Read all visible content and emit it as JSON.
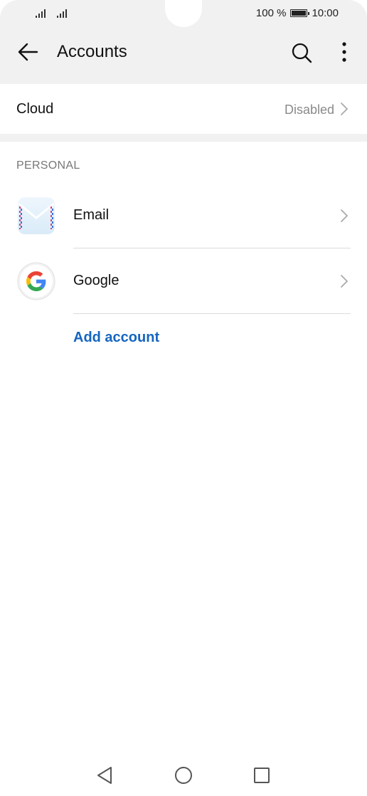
{
  "status_bar": {
    "battery_text": "100 %",
    "time": "10:00"
  },
  "app_bar": {
    "title": "Accounts",
    "back_icon": "arrow-left-icon",
    "search_icon": "search-icon",
    "more_icon": "more-vertical-icon"
  },
  "cloud": {
    "label": "Cloud",
    "value": "Disabled"
  },
  "personal": {
    "header": "PERSONAL",
    "accounts": [
      {
        "label": "Email",
        "icon": "email-envelope-icon"
      },
      {
        "label": "Google",
        "icon": "google-icon"
      }
    ],
    "add_label": "Add account"
  },
  "colors": {
    "accent": "#1565c0",
    "header_bg": "#f1f1f1",
    "secondary_text": "#8a8a8a"
  },
  "nav": {
    "back_icon": "nav-back-icon",
    "home_icon": "nav-home-icon",
    "recents_icon": "nav-recents-icon"
  }
}
